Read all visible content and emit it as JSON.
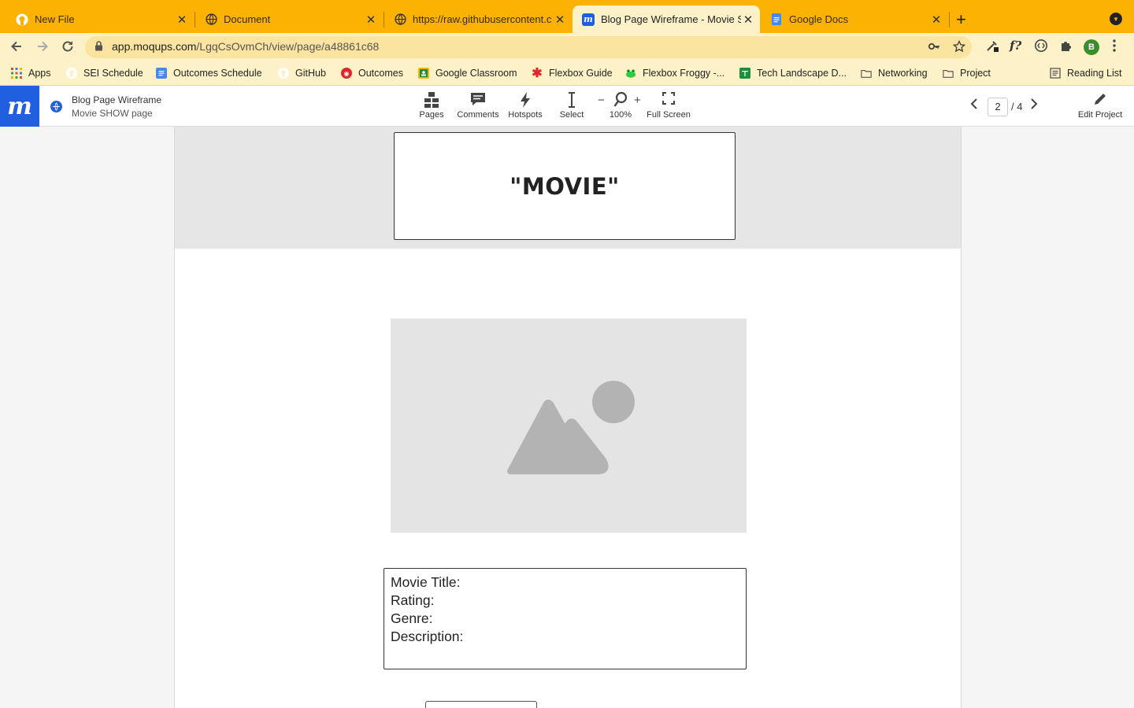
{
  "browser": {
    "tabs": [
      {
        "label": "New File",
        "icon": "github-icon"
      },
      {
        "label": "Document",
        "icon": "globe-icon"
      },
      {
        "label": "https://raw.githubusercontent.c",
        "icon": "globe-icon"
      },
      {
        "label": "Blog Page Wireframe - Movie S",
        "icon": "moqups-icon",
        "active": true
      },
      {
        "label": "Google Docs",
        "icon": "google-docs-icon"
      }
    ],
    "url_host": "app.moqups.com",
    "url_path": "/LgqCsOvmCh/view/page/a48861c68",
    "profile_initial": "B",
    "bookmarks": [
      {
        "label": "Apps",
        "icon": "apps-grid-icon"
      },
      {
        "label": "SEI Schedule",
        "icon": "github-icon"
      },
      {
        "label": "Outcomes Schedule",
        "icon": "google-docs-icon"
      },
      {
        "label": "GitHub",
        "icon": "github-icon"
      },
      {
        "label": "Outcomes",
        "icon": "outcomes-icon"
      },
      {
        "label": "Google Classroom",
        "icon": "classroom-icon"
      },
      {
        "label": "Flexbox Guide",
        "icon": "asterisk-icon"
      },
      {
        "label": "Flexbox Froggy -...",
        "icon": "frog-icon"
      },
      {
        "label": "Tech Landscape D...",
        "icon": "google-sheets-icon"
      },
      {
        "label": "Networking",
        "icon": "folder-icon"
      },
      {
        "label": "Project",
        "icon": "folder-icon"
      }
    ],
    "reading_list": "Reading List"
  },
  "app": {
    "logo": "m",
    "project_name": "Blog Page Wireframe",
    "page_name": "Movie SHOW page",
    "tools": {
      "pages": "Pages",
      "comments": "Comments",
      "hotspots": "Hotspots",
      "select": "Select",
      "zoom": "100%",
      "fullscreen": "Full Screen"
    },
    "pager": {
      "current": "2",
      "total": "/ 4"
    },
    "edit_project": "Edit Project"
  },
  "wireframe": {
    "title": "\"MOVIE\"",
    "info_lines": [
      "Movie Title:",
      "Rating:",
      "Genre:",
      "Description:"
    ]
  },
  "colors": {
    "tabbar": "#fbb202",
    "toolbar": "#fdf1c8",
    "moqups_blue": "#1f5fe0",
    "page_band": "#e6e6e6"
  }
}
